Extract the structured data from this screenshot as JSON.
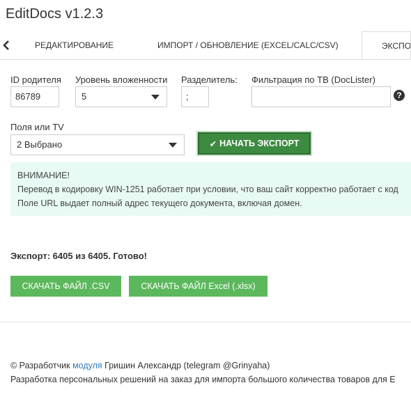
{
  "app": {
    "title": "EditDocs v1.2.3"
  },
  "tabs": [
    {
      "label": "РЕДАКТИРОВАНИЕ"
    },
    {
      "label": "ИМПОРТ / ОБНОВЛЕНИЕ (EXCEL/CALC/CSV)"
    },
    {
      "label": "ЭКСПО"
    }
  ],
  "form": {
    "parent_id": {
      "label": "ID родителя",
      "value": "86789"
    },
    "depth": {
      "label": "Уровень вложенности",
      "value": "5"
    },
    "separator": {
      "label": "Разделитель:",
      "value": ";"
    },
    "filter": {
      "label": "Фильтрация по TB (DocLister)",
      "value": ""
    },
    "fields": {
      "label": "Поля или TV",
      "value": "2 Выбрано"
    },
    "start_button": "НАЧАТЬ ЭКСПОРТ"
  },
  "alert": {
    "title": "ВНИМАНИЕ!",
    "line1": "Перевод в кодировку WIN-1251 работает при условии, что ваш сайт корректно работает с код",
    "line2": "Поле URL выдает полный адрес текущего документа, включая домен."
  },
  "status": "Экспорт: 6405 из 6405. Готово!",
  "downloads": {
    "csv": "СКАЧАТЬ ФАЙЛ .CSV",
    "xlsx": "СКАЧАТЬ ФАЙЛ Excel (.xlsx)"
  },
  "footer": {
    "copyright_prefix": "© Разработчик",
    "link": "модуля",
    "author": "Гришин Александр (telegram @Grinyaha)",
    "line2": "Разработка персональных решений на заказ для импорта большого количества товаров для E"
  },
  "icons": {
    "help": "?",
    "chevron_left": "‹",
    "check": "✔"
  }
}
